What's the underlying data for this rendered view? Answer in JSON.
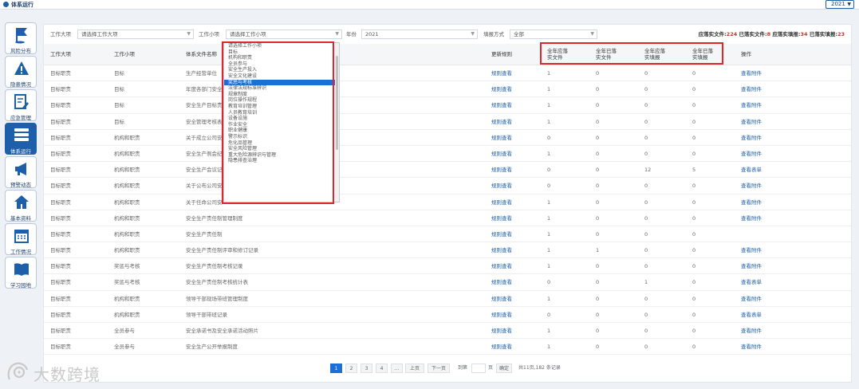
{
  "header": {
    "title": "体系运行",
    "year": "2021"
  },
  "sidebar": {
    "items": [
      {
        "label": "风险分布",
        "icon": "flag-icon",
        "active": false
      },
      {
        "label": "隐患情况",
        "icon": "warning-icon",
        "active": false
      },
      {
        "label": "应急管理",
        "icon": "document-edit-icon",
        "active": false
      },
      {
        "label": "体系运行",
        "icon": "system-stack-icon",
        "active": true
      },
      {
        "label": "预警动态",
        "icon": "megaphone-icon",
        "active": false
      },
      {
        "label": "基本资料",
        "icon": "home-icon",
        "active": false
      },
      {
        "label": "工作情况",
        "icon": "calendar-icon",
        "active": false
      },
      {
        "label": "学习园地",
        "icon": "book-icon",
        "active": false
      }
    ]
  },
  "filters": {
    "category_label": "工作大项",
    "category_value": "请选择工作大项",
    "subcategory_label": "工作小项",
    "subcategory_value": "请选择工作小项",
    "year_label": "年份",
    "year_value": "2021",
    "method_label": "填报方式",
    "method_value": "全部"
  },
  "summary": {
    "l1": "应落实文件:",
    "v1": "224",
    "l2": "已落实文件:",
    "v2": "8",
    "l3": "应落实填报:",
    "v3": "34",
    "l4": "已落实填报:",
    "v4": "23"
  },
  "table": {
    "headers": {
      "category": "工作大项",
      "subcategory": "工作小项",
      "doc": "体系文件名称",
      "rule": "更新规则",
      "should_docs_1": "全年应落",
      "should_docs_2": "实文件",
      "done_docs_1": "全年已落",
      "done_docs_2": "实文件",
      "should_fill_1": "全年应落",
      "should_fill_2": "实填报",
      "done_fill_1": "全年已落",
      "done_fill_2": "实填报",
      "ops": "操作"
    },
    "rows": [
      {
        "c": "目标职责",
        "s": "目标",
        "d": "生产经营单位",
        "r": "规则查看",
        "a": "1",
        "b": "0",
        "e": "0",
        "f": "0",
        "o": "查看附件"
      },
      {
        "c": "目标职责",
        "s": "目标",
        "d": "年度各部门安全",
        "r": "规则查看",
        "a": "1",
        "b": "0",
        "e": "0",
        "f": "0",
        "o": "查看附件"
      },
      {
        "c": "目标职责",
        "s": "目标",
        "d": "安全生产目标责",
        "r": "规则查看",
        "a": "1",
        "b": "0",
        "e": "0",
        "f": "0",
        "o": "查看附件"
      },
      {
        "c": "目标职责",
        "s": "目标",
        "d": "安全管理考核表",
        "r": "规则查看",
        "a": "1",
        "b": "0",
        "e": "0",
        "f": "0",
        "o": "查看附件"
      },
      {
        "c": "目标职责",
        "s": "机构和职责",
        "d": "关于成立公司安",
        "r": "规则查看",
        "a": "0",
        "b": "0",
        "e": "0",
        "f": "0",
        "o": "查看附件"
      },
      {
        "c": "目标职责",
        "s": "机构和职责",
        "d": "安全生产例会纪",
        "r": "规则查看",
        "a": "1",
        "b": "0",
        "e": "0",
        "f": "0",
        "o": "查看附件"
      },
      {
        "c": "目标职责",
        "s": "机构和职责",
        "d": "安全生产会议记",
        "r": "规则查看",
        "a": "0",
        "b": "0",
        "e": "12",
        "f": "5",
        "o": "查看表单"
      },
      {
        "c": "目标职责",
        "s": "机构和职责",
        "d": "关于公布公司安",
        "r": "规则查看",
        "a": "0",
        "b": "0",
        "e": "0",
        "f": "0",
        "o": "查看附件"
      },
      {
        "c": "目标职责",
        "s": "机构和职责",
        "d": "关于任命公司安",
        "r": "规则查看",
        "a": "1",
        "b": "0",
        "e": "0",
        "f": "0",
        "o": "查看附件"
      },
      {
        "c": "目标职责",
        "s": "机构和职责",
        "d": "安全生产责任制管理制度",
        "r": "规则查看",
        "a": "1",
        "b": "0",
        "e": "0",
        "f": "0",
        "o": "查看附件"
      },
      {
        "c": "目标职责",
        "s": "机构和职责",
        "d": "安全生产责任制",
        "r": "规则查看",
        "a": "1",
        "b": "0",
        "e": "0",
        "f": "0",
        "o": ""
      },
      {
        "c": "目标职责",
        "s": "机构和职责",
        "d": "安全生产责任制评审和修订记录",
        "r": "规则查看",
        "a": "1",
        "b": "1",
        "e": "0",
        "f": "0",
        "o": "查看附件"
      },
      {
        "c": "目标职责",
        "s": "奖惩与考核",
        "d": "安全生产责任制考核记录",
        "r": "规则查看",
        "a": "1",
        "b": "0",
        "e": "0",
        "f": "0",
        "o": "查看附件"
      },
      {
        "c": "目标职责",
        "s": "奖惩与考核",
        "d": "安全生产责任制考核统计表",
        "r": "规则查看",
        "a": "0",
        "b": "0",
        "e": "1",
        "f": "0",
        "o": "查看表单"
      },
      {
        "c": "目标职责",
        "s": "机构和职责",
        "d": "领导干部现场带班管理制度",
        "r": "规则查看",
        "a": "1",
        "b": "0",
        "e": "0",
        "f": "0",
        "o": "查看附件"
      },
      {
        "c": "目标职责",
        "s": "机构和职责",
        "d": "领导干部带班记录",
        "r": "规则查看",
        "a": "0",
        "b": "0",
        "e": "0",
        "f": "0",
        "o": "查看表单"
      },
      {
        "c": "目标职责",
        "s": "全员参与",
        "d": "安全承诺书及安全承诺活动照片",
        "r": "规则查看",
        "a": "1",
        "b": "0",
        "e": "0",
        "f": "0",
        "o": "查看附件"
      },
      {
        "c": "目标职责",
        "s": "全员参与",
        "d": "安全生产公开举报制度",
        "r": "规则查看",
        "a": "1",
        "b": "0",
        "e": "0",
        "f": "0",
        "o": "查看附件"
      }
    ]
  },
  "dropdown": {
    "options": [
      "请选择工作小项",
      "目标",
      "机构和职责",
      "全员参与",
      "安全生产投入",
      "安全文化建设",
      "奖惩与考核",
      "法律法规标准辨识",
      "规章制度",
      "岗位操作规程",
      "教育培训管理",
      "人员教育培训",
      "设备设施",
      "作业安全",
      "职业健康",
      "警示标识",
      "危化品管理",
      "安全风险管理",
      "重大危险源辨识与管理",
      "隐患排查治理"
    ],
    "highlighted_index": 6
  },
  "pagination": {
    "pages": [
      "1",
      "2",
      "3",
      "4",
      "..."
    ],
    "current": "1",
    "prev": "上页",
    "next": "下一页",
    "goto_label": "到第",
    "page_unit": "页",
    "confirm": "确定",
    "total": "共11页,182 条记录"
  },
  "watermark": "大数跨境",
  "colors": {
    "accent": "#1d5fa8",
    "highlight_box": "#e0262a",
    "summary_value": "#c0392b"
  }
}
